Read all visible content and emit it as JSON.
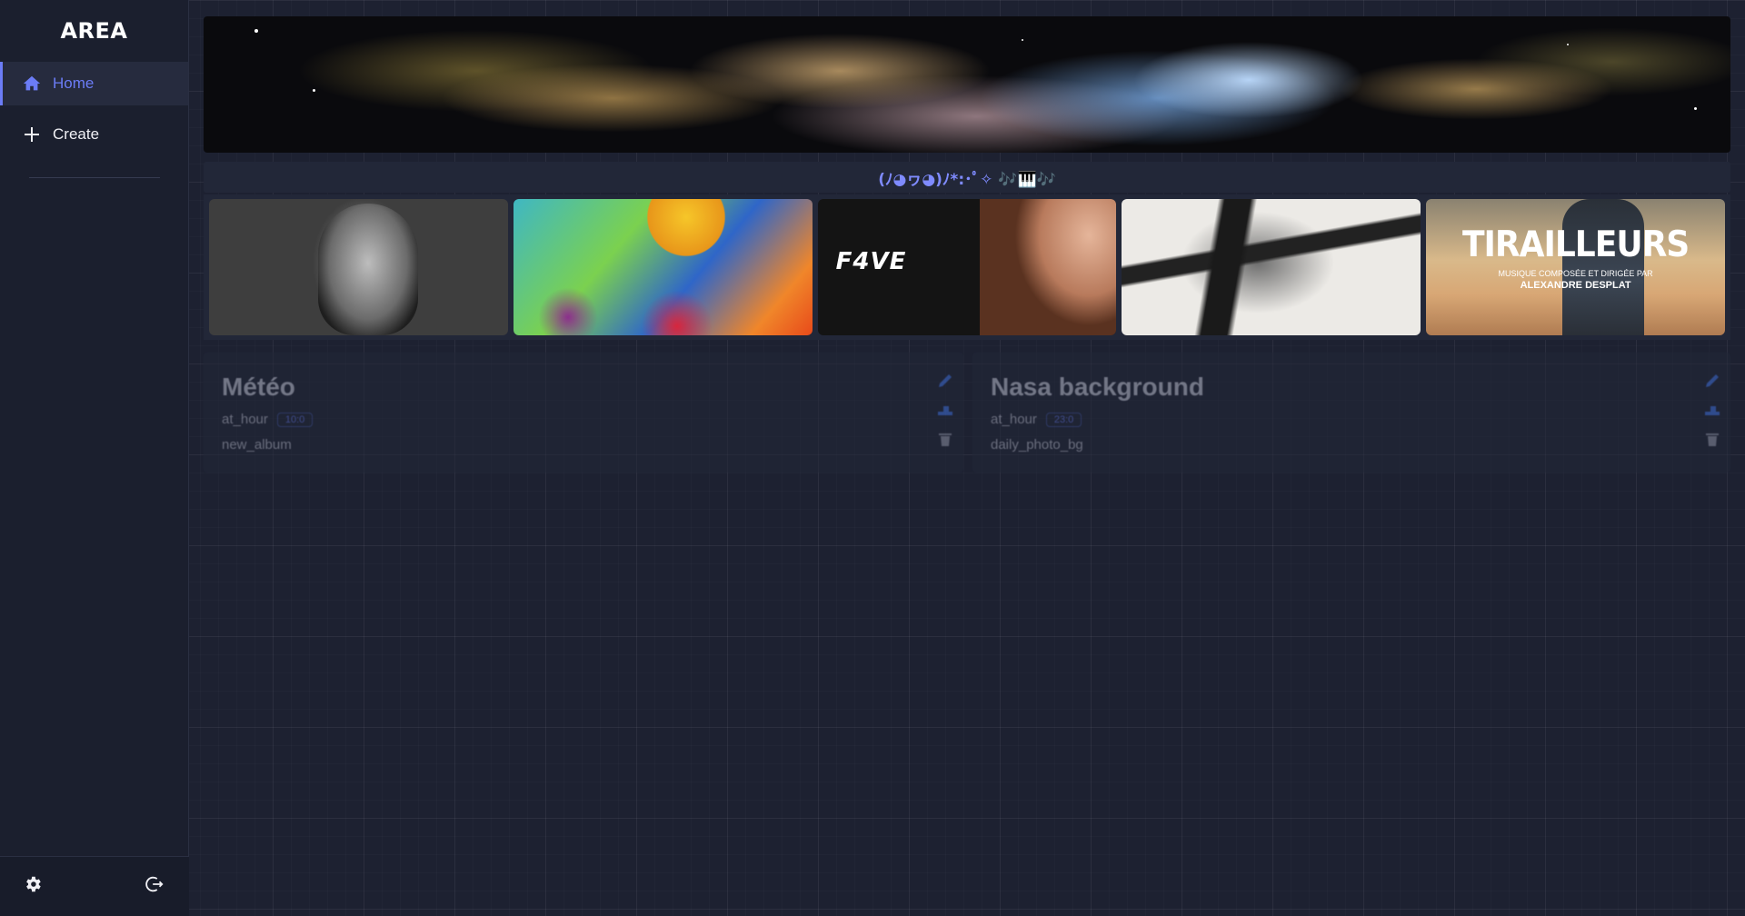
{
  "sidebar": {
    "brand": "AREA",
    "items": [
      {
        "label": "Home",
        "icon": "home-icon",
        "active": true
      },
      {
        "label": "Create",
        "icon": "plus-icon",
        "active": false
      }
    ],
    "footer": {
      "settings_icon": "gear-icon",
      "logout_icon": "logout-icon"
    }
  },
  "banner": {
    "icon": "nebula-image"
  },
  "music_bar": {
    "text": "(ﾉ◕ヮ◕)ﾉ*:･ﾟ✧ 🎶🎹🎶"
  },
  "albums": [
    {
      "name": "portrait-album"
    },
    {
      "name": "painted-sun-album"
    },
    {
      "name": "five-album",
      "logo": "F4VE"
    },
    {
      "name": "ink-album"
    },
    {
      "name": "tirailleurs-album",
      "title": "TIRAILLEURS",
      "subtitle": "MUSIQUE COMPOSÉE ET DIRIGÉE PAR",
      "author": "ALEXANDRE DESPLAT"
    }
  ],
  "areas": [
    {
      "title": "Météo",
      "action": "at_hour",
      "badge": "10:0",
      "reaction": "new_album"
    },
    {
      "title": "Nasa background",
      "action": "at_hour",
      "badge": "23:0",
      "reaction": "daily_photo_bg"
    }
  ],
  "colors": {
    "accent": "#6b7cf6",
    "background": "#1d2131",
    "panel": "#222738"
  }
}
